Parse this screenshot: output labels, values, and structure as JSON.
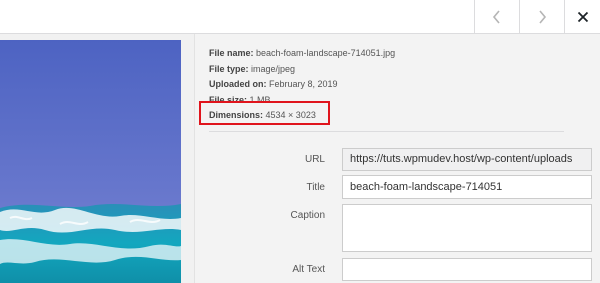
{
  "navigation": {
    "previous_icon": "chevron-left-icon",
    "next_icon": "chevron-right-icon",
    "close_icon": "close-x-icon"
  },
  "attachment": {
    "file_name_label": "File name:",
    "file_name": "beach-foam-landscape-714051.jpg",
    "file_type_label": "File type:",
    "file_type": "image/jpeg",
    "uploaded_on_label": "Uploaded on:",
    "uploaded_on": "February 8, 2019",
    "file_size_label": "File size:",
    "file_size": "1 MB",
    "dimensions_label": "Dimensions:",
    "dimensions": "4534 × 3023"
  },
  "fields": {
    "url_label": "URL",
    "url_value": "https://tuts.wpmudev.host/wp-content/uploads",
    "title_label": "Title",
    "title_value": "beach-foam-landscape-714051",
    "caption_label": "Caption",
    "caption_value": "",
    "alt_label": "Alt Text",
    "alt_value": ""
  },
  "colors": {
    "highlight_border": "#e0141c",
    "sea": "#1aa6c0",
    "sky": "#5a70c8"
  }
}
